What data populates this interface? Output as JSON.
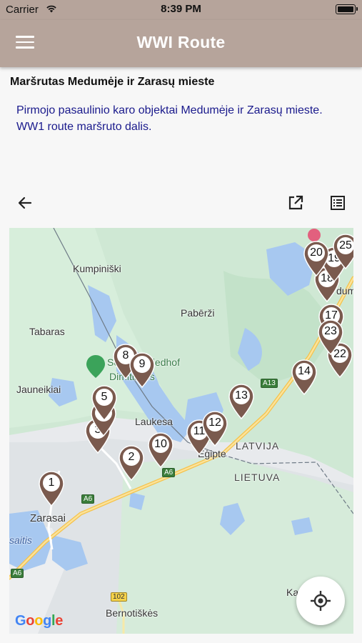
{
  "status_bar": {
    "carrier": "Carrier",
    "time": "8:39 PM"
  },
  "app_bar": {
    "title": "WWI Route",
    "menu_icon": "hamburger-menu-icon"
  },
  "content": {
    "heading": "Maršrutas Medumėje ir Zarasų mieste",
    "description": "Pirmojo pasaulinio karo objektai Medumėje ir Zarasų mieste. WW1 route maršruto dalis."
  },
  "toolbar": {
    "back_icon": "back-arrow-icon",
    "open_external_icon": "open-external-icon",
    "list_icon": "list-icon"
  },
  "map": {
    "places": {
      "kumpiniski": "Kumpiniški",
      "tabaras": "Tabaras",
      "pabarzi": "Pabērži",
      "soldatenfriedhof_1": "Soldatenfriedhof",
      "soldatenfriedhof_2": "Dimitiškės",
      "jauneikiai": "Jauneikiai",
      "laukesa": "Laukesa",
      "egipte": "Ēģipte",
      "latvija": "LATVIJA",
      "lietuva": "LIETUVA",
      "zarasai": "Zarasai",
      "saitis": "saitis",
      "bernotiskes": "Bernotiškės",
      "ka": "Ka",
      "dum": "dum"
    },
    "roads": {
      "a13": "A13",
      "a6_1": "A6",
      "a6_2": "A6",
      "a6_3": "A6",
      "r102": "102"
    },
    "markers": [
      "1",
      "2",
      "3",
      "4",
      "5",
      "8",
      "9",
      "10",
      "11",
      "12",
      "13",
      "14",
      "17",
      "18",
      "19",
      "20",
      "22",
      "23",
      "25"
    ],
    "marker_color": "#7a5a4e",
    "attribution": "Google",
    "locate_icon": "my-location-icon"
  }
}
